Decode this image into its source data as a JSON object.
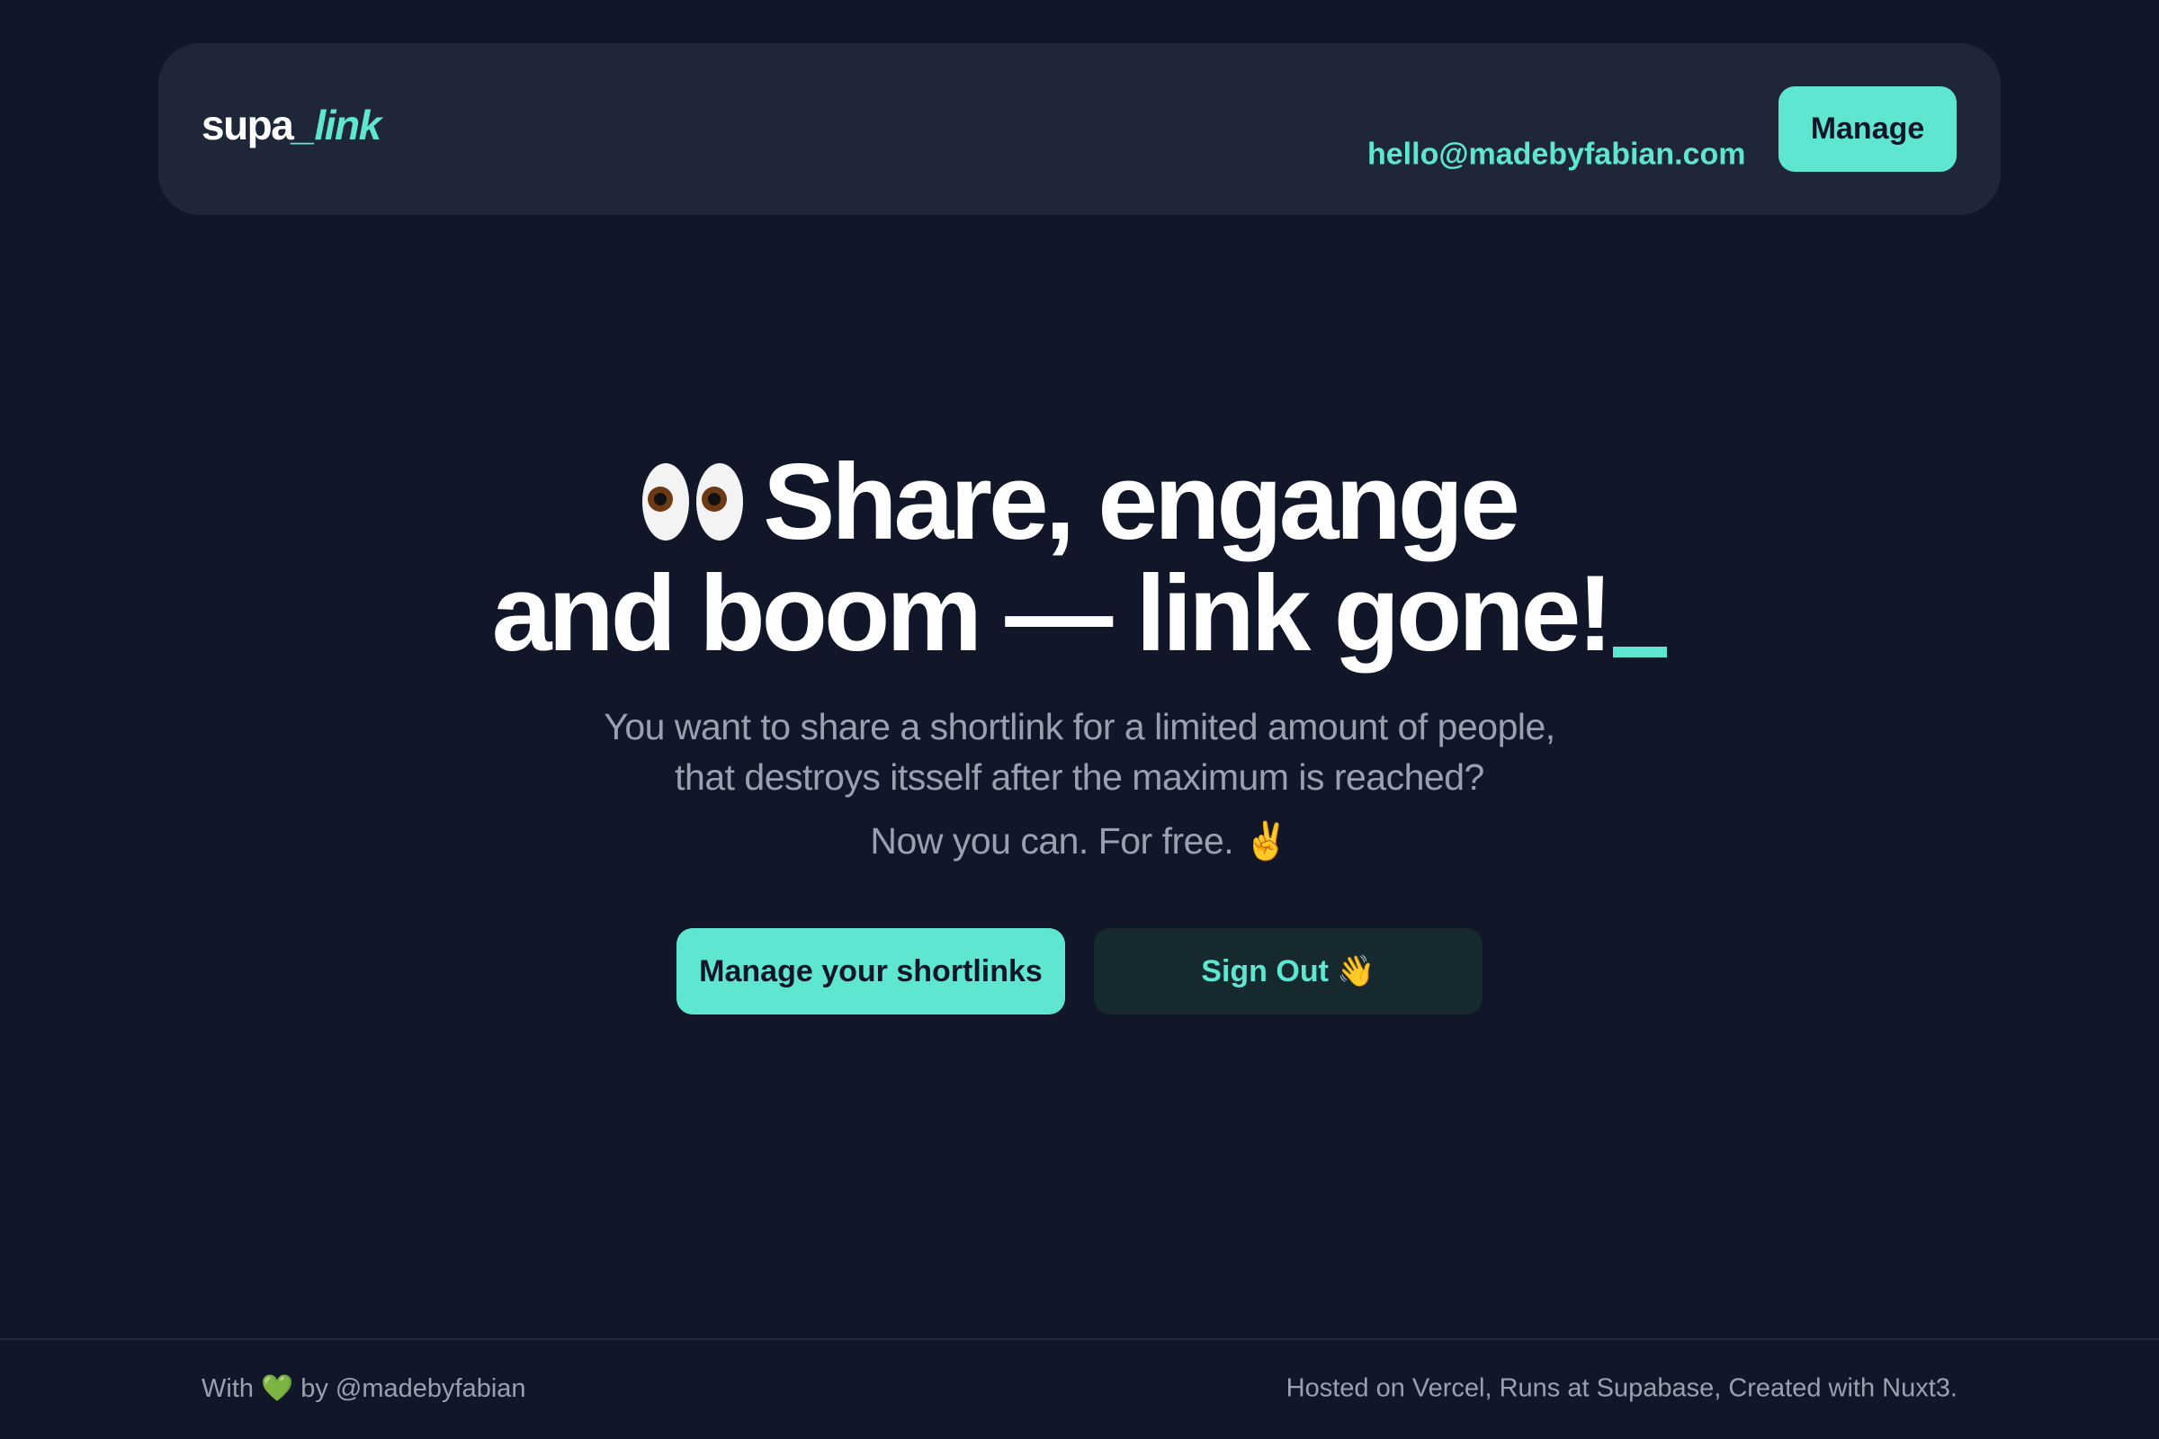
{
  "header": {
    "logo_main": "supa",
    "logo_accent": "_link",
    "email": "hello@madebyfabian.com",
    "manage_label": "Manage"
  },
  "hero": {
    "title_line1": "Share, engange",
    "title_line2": "and boom — link gone!",
    "title_icon": "eyes-icon",
    "subtitle_line1": "You want to share a shortlink for a limited amount of people,",
    "subtitle_line2": "that destroys itsself after the maximum is reached?",
    "tagline": "Now you can. For free. ✌️",
    "primary_button": "Manage your shortlinks",
    "secondary_button": "Sign Out 👋"
  },
  "footer": {
    "left_prefix": "With",
    "left_heart": "💚",
    "left_suffix": "by @madebyfabian",
    "right": "Hosted on Vercel, Runs at Supabase, Created with Nuxt3."
  },
  "colors": {
    "background": "#111729",
    "header_bg": "#1f2638",
    "accent": "#5ee6d0",
    "muted_text": "#9aa1ae"
  }
}
